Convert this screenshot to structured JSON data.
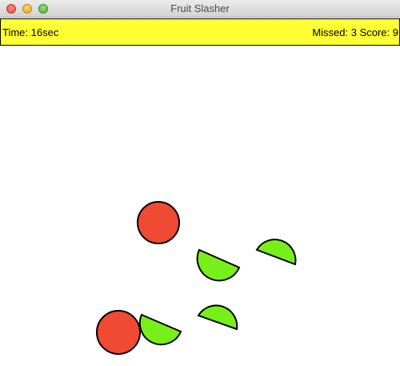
{
  "window": {
    "title": "Fruit Slasher"
  },
  "hud": {
    "time_text": "Time: 16sec",
    "missed_text": "Missed: 3",
    "score_text": "Score: 9"
  },
  "colors": {
    "hud_background": "#ffff33",
    "fruit_red": "#f04a33",
    "fruit_green": "#77f01a",
    "outline": "#000000"
  },
  "fruits": [
    {
      "kind": "whole",
      "color": "red"
    },
    {
      "kind": "sliced-half",
      "color": "green"
    },
    {
      "kind": "sliced-sliver",
      "color": "green"
    },
    {
      "kind": "sliced-sliver",
      "color": "green"
    },
    {
      "kind": "whole",
      "color": "red"
    },
    {
      "kind": "sliced-half",
      "color": "green"
    }
  ]
}
